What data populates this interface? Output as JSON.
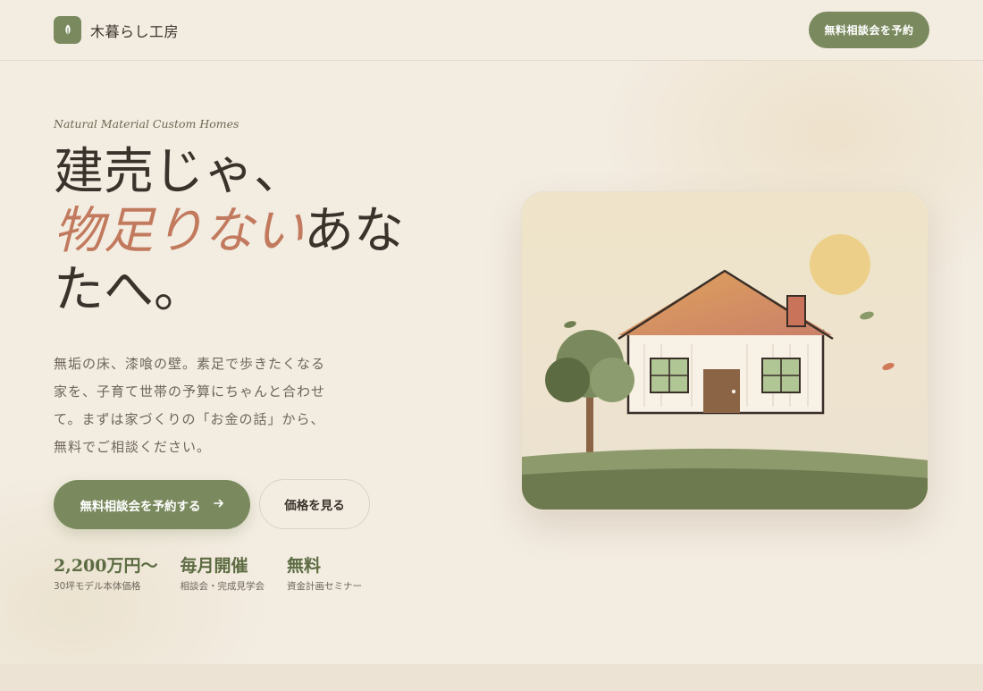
{
  "brand": {
    "name": "木暮らし工房",
    "logo_icon": "leaf-icon",
    "accent": "#7a8a5e"
  },
  "nav": {
    "cta_label": "無料相談会を予約"
  },
  "hero": {
    "eyebrow": "Natural Material Custom Homes",
    "headline": {
      "line1": "建売じゃ、",
      "accent": "物足りない",
      "rest": "あな",
      "line3": "たへ。",
      "accent_color": "#c27a5e"
    },
    "lead": "無垢の床、漆喰の壁。素足で歩きたくなる家を、子育て世帯の予算にちゃんと合わせて。まずは家づくりの「お金の話」から、無料でご相談ください。",
    "primary_cta": {
      "label": "無料相談会を予約する",
      "icon": "arrow-right-icon"
    },
    "secondary_cta": {
      "label": "価格を見る"
    }
  },
  "stats": [
    {
      "value": "2,200万円〜",
      "label": "30坪モデル本体価格"
    },
    {
      "value": "毎月開催",
      "label": "相談会・完成見学会"
    },
    {
      "value": "無料",
      "label": "資金計画セミナー"
    }
  ],
  "illustration": {
    "subject": "house-illustration"
  }
}
